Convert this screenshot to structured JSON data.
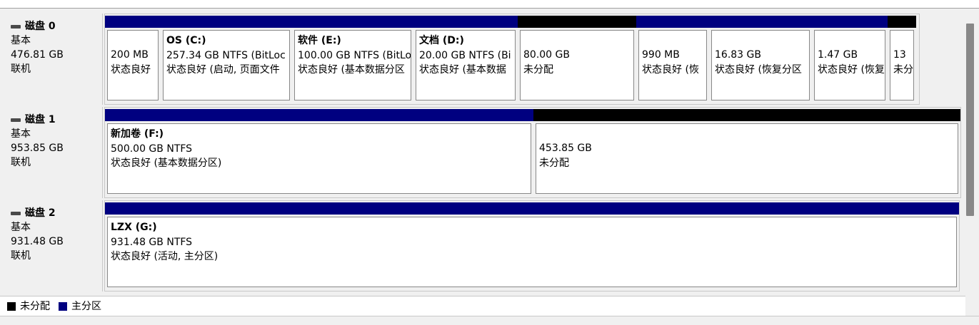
{
  "colors": {
    "primary": "#000080",
    "unallocated": "#000000"
  },
  "disks": [
    {
      "name": "磁盘 0",
      "type": "基本",
      "size": "476.81 GB",
      "status": "联机",
      "partitions": [
        {
          "name": "",
          "line1": "200 MB",
          "line2": "状态良好"
        },
        {
          "name": "OS  (C:)",
          "line1": "257.34 GB NTFS (BitLoc",
          "line2": "状态良好 (启动, 页面文件"
        },
        {
          "name": "软件  (E:)",
          "line1": "100.00 GB NTFS (BitLo",
          "line2": "状态良好 (基本数据分区"
        },
        {
          "name": "文档  (D:)",
          "line1": "20.00 GB NTFS (Bi",
          "line2": "状态良好 (基本数据"
        },
        {
          "name": "",
          "line1": "80.00 GB",
          "line2": "未分配"
        },
        {
          "name": "",
          "line1": "990 MB",
          "line2": "状态良好 (恢"
        },
        {
          "name": "",
          "line1": "16.83 GB",
          "line2": "状态良好 (恢复分区"
        },
        {
          "name": "",
          "line1": "1.47 GB",
          "line2": "状态良好 (恢复"
        },
        {
          "name": "",
          "line1": "13",
          "line2": "未分"
        }
      ]
    },
    {
      "name": "磁盘 1",
      "type": "基本",
      "size": "953.85 GB",
      "status": "联机",
      "partitions": [
        {
          "name": "新加卷  (F:)",
          "line1": "500.00 GB NTFS",
          "line2": "状态良好 (基本数据分区)"
        },
        {
          "name": "",
          "line1": "453.85 GB",
          "line2": "未分配"
        }
      ]
    },
    {
      "name": "磁盘 2",
      "type": "基本",
      "size": "931.48 GB",
      "status": "联机",
      "partitions": [
        {
          "name": "LZX  (G:)",
          "line1": "931.48 GB NTFS",
          "line2": "状态良好 (活动, 主分区)"
        }
      ]
    }
  ],
  "legend": {
    "unallocated": "未分配",
    "primary": "主分区"
  }
}
